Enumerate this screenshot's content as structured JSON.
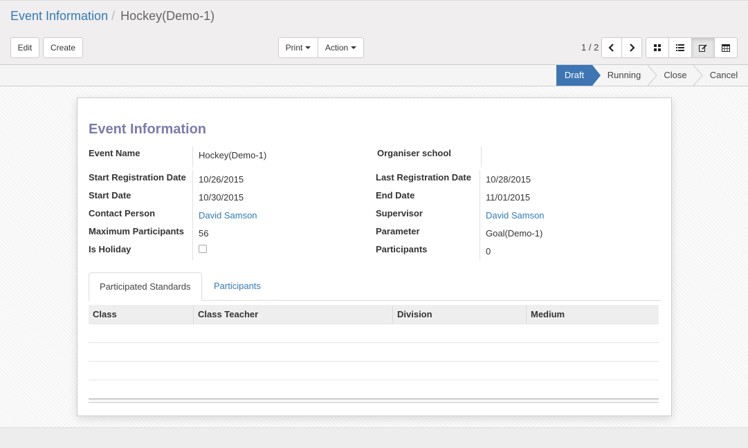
{
  "breadcrumb": {
    "parent": "Event Information",
    "separator": "/",
    "current": "Hockey(Demo-1)"
  },
  "toolbar": {
    "edit": "Edit",
    "create": "Create",
    "print": "Print",
    "action": "Action"
  },
  "pager": {
    "value": "1 / 2"
  },
  "views": [
    "kanban-icon",
    "list-icon",
    "form-icon",
    "calendar-icon"
  ],
  "status": {
    "stages": [
      "Draft",
      "Running",
      "Close",
      "Cancel"
    ],
    "active": "Draft",
    "active_color": "#3e76b4"
  },
  "form": {
    "title": "Event Information",
    "left": [
      {
        "label": "Event Name",
        "value": "Hockey(Demo-1)"
      },
      {
        "label": "Start Registration Date",
        "value": "10/26/2015"
      },
      {
        "label": "Start Date",
        "value": "10/30/2015"
      },
      {
        "label": "Contact Person",
        "value": "David Samson"
      },
      {
        "label": "Maximum Participants",
        "value": "56"
      },
      {
        "label": "Is Holiday",
        "value": ""
      }
    ],
    "right": [
      {
        "label": "Organiser school",
        "value": ""
      },
      {
        "label": "Last Registration Date",
        "value": "10/28/2015"
      },
      {
        "label": "End Date",
        "value": "11/01/2015"
      },
      {
        "label": "Supervisor",
        "value": "David Samson"
      },
      {
        "label": "Parameter",
        "value": "Goal(Demo-1)"
      },
      {
        "label": "Participants",
        "value": "0"
      }
    ]
  },
  "tabs": [
    "Participated Standards",
    "Participants"
  ],
  "table": {
    "columns": [
      "Class",
      "Class Teacher",
      "Division",
      "Medium"
    ],
    "rows": []
  },
  "colors": {
    "link": "#337ab7",
    "title": "#7c7bad"
  }
}
